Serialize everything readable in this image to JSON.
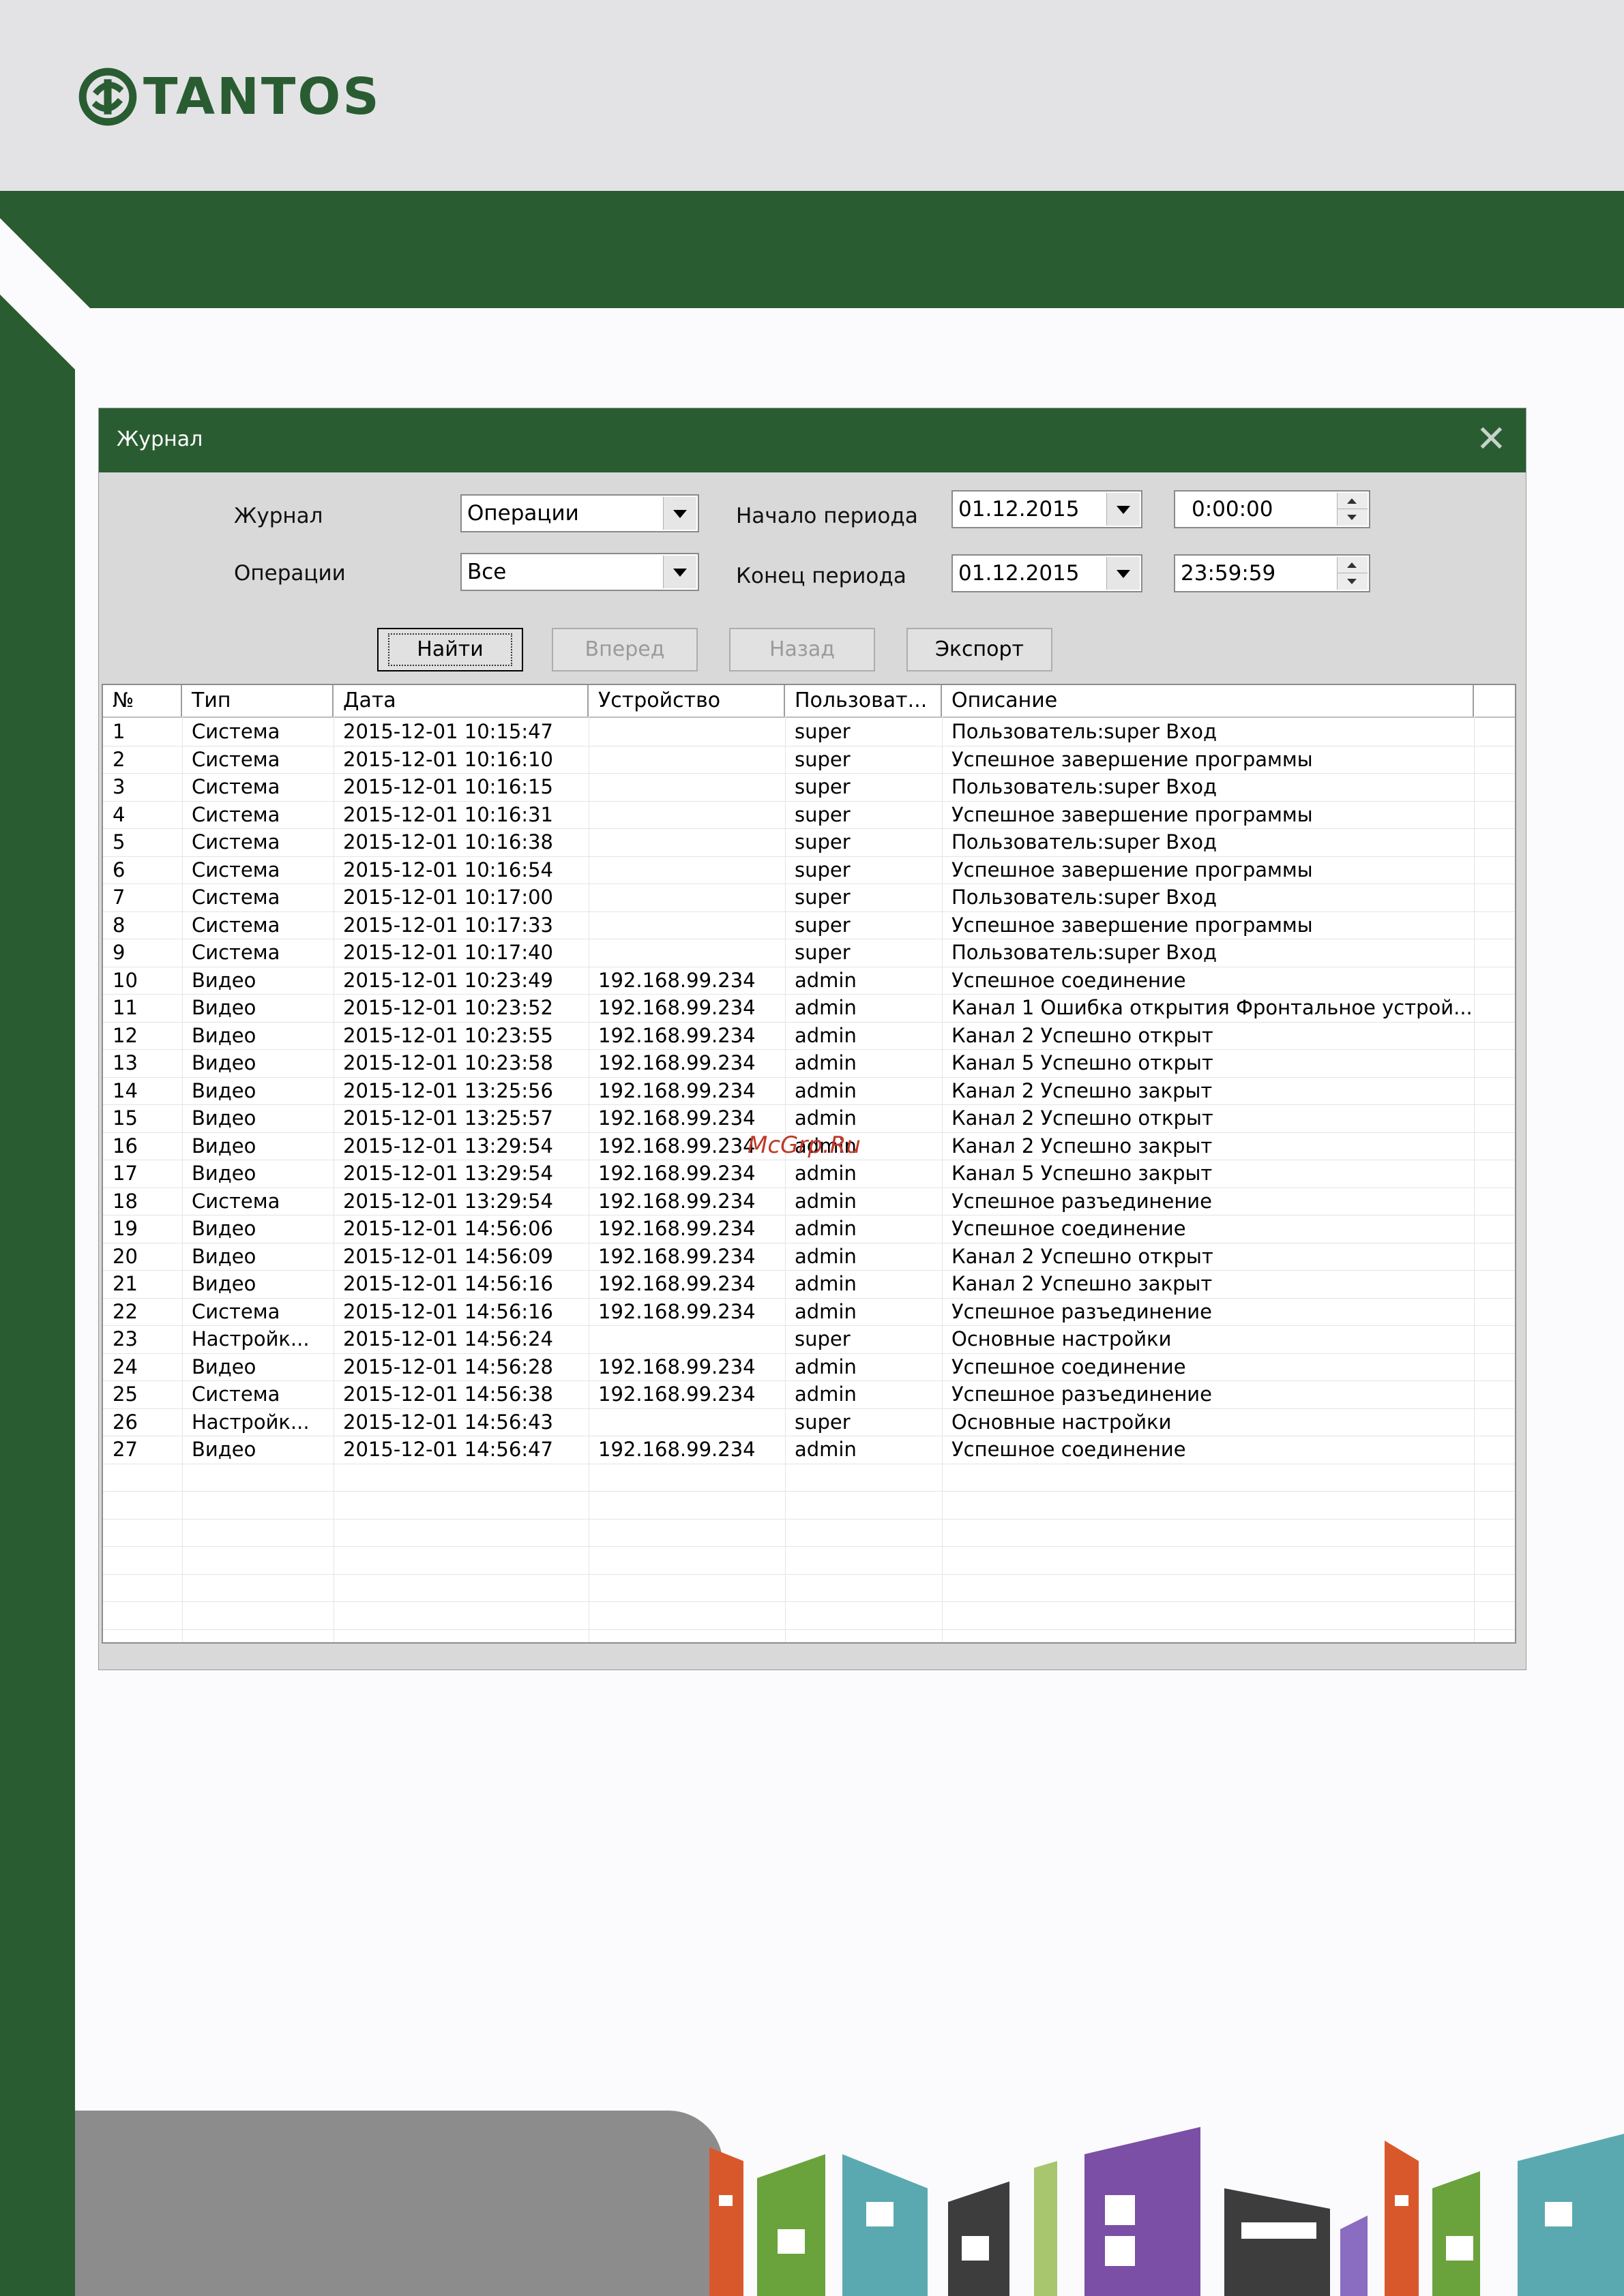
{
  "brand": {
    "name": "TANTOS",
    "color": "#2a5c32"
  },
  "dialog": {
    "title": "Журнал",
    "labels": {
      "journal": "Журнал",
      "operations": "Операции",
      "period_start": "Начало периода",
      "period_end": "Конец периода"
    },
    "journal_value": "Операции",
    "operations_value": "Все",
    "start_date": "01.12.2015",
    "start_time": "0:00:00",
    "end_date": "01.12.2015",
    "end_time": "23:59:59",
    "buttons": {
      "find": "Найти",
      "forward": "Вперед",
      "back": "Назад",
      "export": "Экспорт"
    }
  },
  "table": {
    "columns": [
      "№",
      "Тип",
      "Дата",
      "Устройство",
      "Пользоват...",
      "Описание"
    ],
    "rows": [
      [
        "1",
        "Система",
        "2015-12-01 10:15:47",
        "",
        "super",
        "Пользователь:super  Вход"
      ],
      [
        "2",
        "Система",
        "2015-12-01 10:16:10",
        "",
        "super",
        "Успешное завершение программы"
      ],
      [
        "3",
        "Система",
        "2015-12-01 10:16:15",
        "",
        "super",
        "Пользователь:super  Вход"
      ],
      [
        "4",
        "Система",
        "2015-12-01 10:16:31",
        "",
        "super",
        "Успешное завершение программы"
      ],
      [
        "5",
        "Система",
        "2015-12-01 10:16:38",
        "",
        "super",
        "Пользователь:super  Вход"
      ],
      [
        "6",
        "Система",
        "2015-12-01 10:16:54",
        "",
        "super",
        "Успешное завершение программы"
      ],
      [
        "7",
        "Система",
        "2015-12-01 10:17:00",
        "",
        "super",
        "Пользователь:super  Вход"
      ],
      [
        "8",
        "Система",
        "2015-12-01 10:17:33",
        "",
        "super",
        "Успешное завершение программы"
      ],
      [
        "9",
        "Система",
        "2015-12-01 10:17:40",
        "",
        "super",
        "Пользователь:super  Вход"
      ],
      [
        "10",
        "Видео",
        "2015-12-01 10:23:49",
        "192.168.99.234",
        "admin",
        "Успешное соединение"
      ],
      [
        "11",
        "Видео",
        "2015-12-01 10:23:52",
        "192.168.99.234",
        "admin",
        "Канал 1 Ошибка открытия Фронтальное устрой..."
      ],
      [
        "12",
        "Видео",
        "2015-12-01 10:23:55",
        "192.168.99.234",
        "admin",
        "Канал 2 Успешно открыт"
      ],
      [
        "13",
        "Видео",
        "2015-12-01 10:23:58",
        "192.168.99.234",
        "admin",
        "Канал 5 Успешно открыт"
      ],
      [
        "14",
        "Видео",
        "2015-12-01 13:25:56",
        "192.168.99.234",
        "admin",
        "Канал 2 Успешно закрыт"
      ],
      [
        "15",
        "Видео",
        "2015-12-01 13:25:57",
        "192.168.99.234",
        "admin",
        "Канал 2 Успешно открыт"
      ],
      [
        "16",
        "Видео",
        "2015-12-01 13:29:54",
        "192.168.99.234",
        "admin",
        "Канал 2 Успешно закрыт"
      ],
      [
        "17",
        "Видео",
        "2015-12-01 13:29:54",
        "192.168.99.234",
        "admin",
        "Канал 5 Успешно закрыт"
      ],
      [
        "18",
        "Система",
        "2015-12-01 13:29:54",
        "192.168.99.234",
        "admin",
        "Успешное разъединение"
      ],
      [
        "19",
        "Видео",
        "2015-12-01 14:56:06",
        "192.168.99.234",
        "admin",
        "Успешное соединение"
      ],
      [
        "20",
        "Видео",
        "2015-12-01 14:56:09",
        "192.168.99.234",
        "admin",
        "Канал 2 Успешно открыт"
      ],
      [
        "21",
        "Видео",
        "2015-12-01 14:56:16",
        "192.168.99.234",
        "admin",
        "Канал 2 Успешно закрыт"
      ],
      [
        "22",
        "Система",
        "2015-12-01 14:56:16",
        "192.168.99.234",
        "admin",
        "Успешное разъединение"
      ],
      [
        "23",
        "Настройк...",
        "2015-12-01 14:56:24",
        "",
        "super",
        "Основные настройки"
      ],
      [
        "24",
        "Видео",
        "2015-12-01 14:56:28",
        "192.168.99.234",
        "admin",
        "Успешное соединение"
      ],
      [
        "25",
        "Система",
        "2015-12-01 14:56:38",
        "192.168.99.234",
        "admin",
        "Успешное разъединение"
      ],
      [
        "26",
        "Настройк...",
        "2015-12-01 14:56:43",
        "",
        "super",
        "Основные настройки"
      ],
      [
        "27",
        "Видео",
        "2015-12-01 14:56:47",
        "192.168.99.234",
        "admin",
        "Успешное соединение"
      ]
    ]
  },
  "watermark": "McGrp.Ru"
}
